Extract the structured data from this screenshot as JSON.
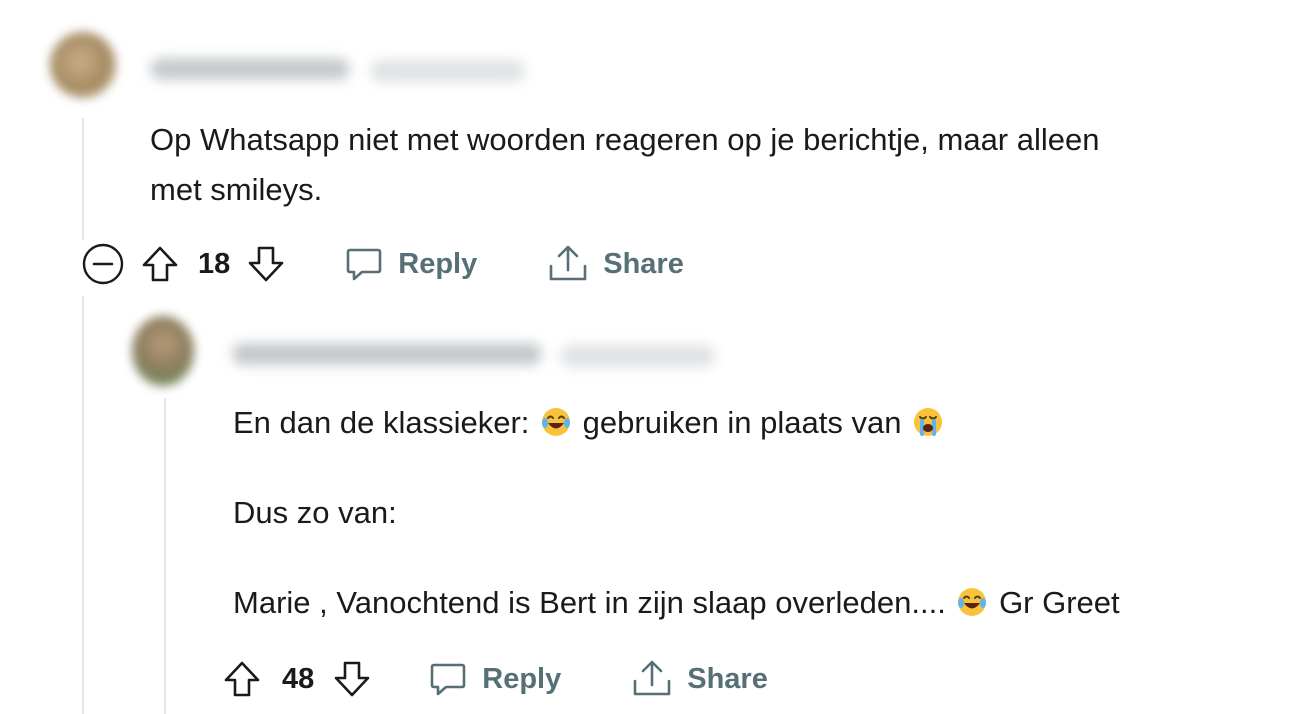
{
  "parent_comment": {
    "text_lines": [
      "Op Whatsapp niet met woorden reageren op je berichtje, maar alleen",
      "met smileys."
    ],
    "score": "18",
    "reply_label": "Reply",
    "share_label": "Share"
  },
  "child_comment": {
    "line1_before": "En dan de klassieker:",
    "line1_emoji1": "😂",
    "line1_middle": "gebruiken in plaats van",
    "line1_emoji2": "😭",
    "line2": "Dus zo van:",
    "line3_before": "Marie , Vanochtend is Bert in zijn slaap overleden....",
    "line3_emoji": "😂",
    "line3_after": "Gr Greet",
    "score": "48",
    "reply_label": "Reply",
    "share_label": "Share"
  },
  "icons": {
    "collapse": "collapse-minus-icon",
    "upvote": "arrow-up-outline-icon",
    "downvote": "arrow-down-outline-icon",
    "reply": "speech-bubble-icon",
    "share": "share-upload-icon"
  },
  "colors": {
    "action_gray": "#576f76",
    "text": "#1a1a1b",
    "thread_line": "#e5e7ea"
  }
}
